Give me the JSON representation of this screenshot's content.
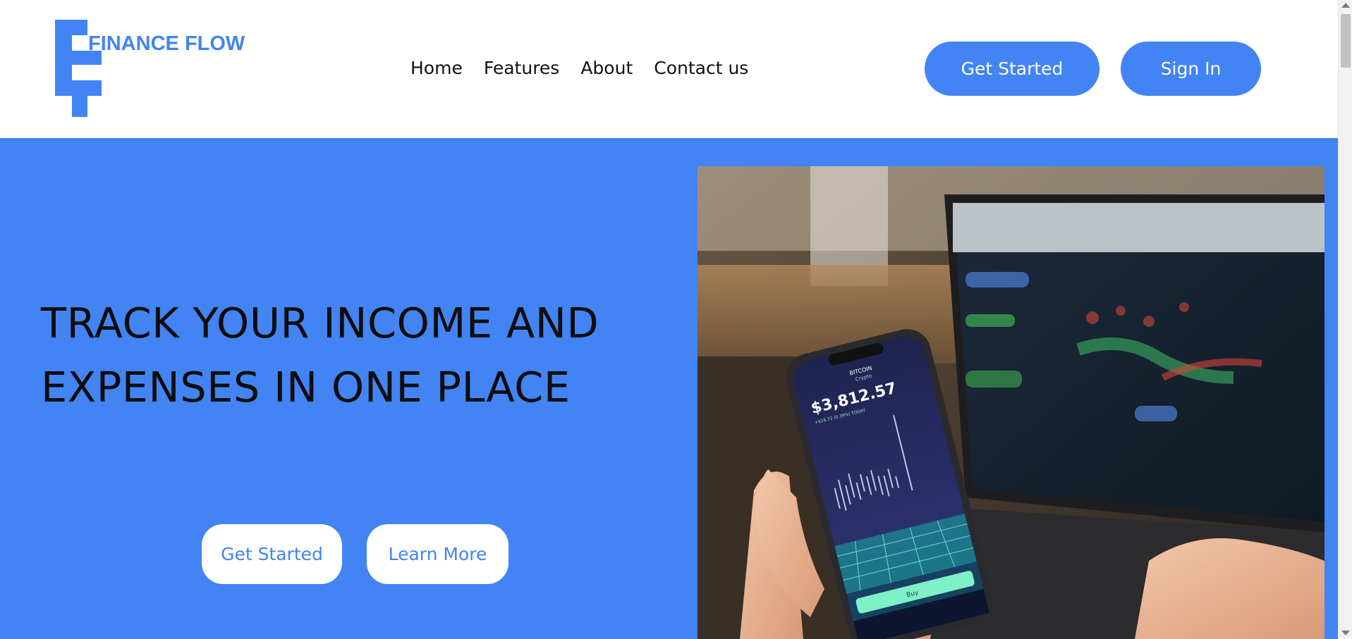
{
  "brand": {
    "name": "FINANCE FLOW",
    "color": "#4284f3"
  },
  "nav": {
    "items": [
      {
        "label": "Home"
      },
      {
        "label": "Features"
      },
      {
        "label": "About"
      },
      {
        "label": "Contact us"
      }
    ]
  },
  "header": {
    "get_started_label": "Get Started",
    "sign_in_label": "Sign In"
  },
  "hero": {
    "title_line1": "TRACK YOUR INCOME AND",
    "title_line2": "EXPENSES IN ONE PLACE",
    "get_started_label": "Get Started",
    "learn_more_label": "Learn More",
    "background_color": "#4284f3",
    "image": {
      "phone_price": "$3,812.57",
      "phone_asset": "BITCOIN",
      "phone_subtitle": "Crypto",
      "phone_change": "+$18.72 (0.39%) TODAY",
      "phone_buy_label": "Buy"
    }
  },
  "icons": {
    "scroll_up": "chevron-up-icon",
    "scroll_down": "chevron-down-icon"
  }
}
